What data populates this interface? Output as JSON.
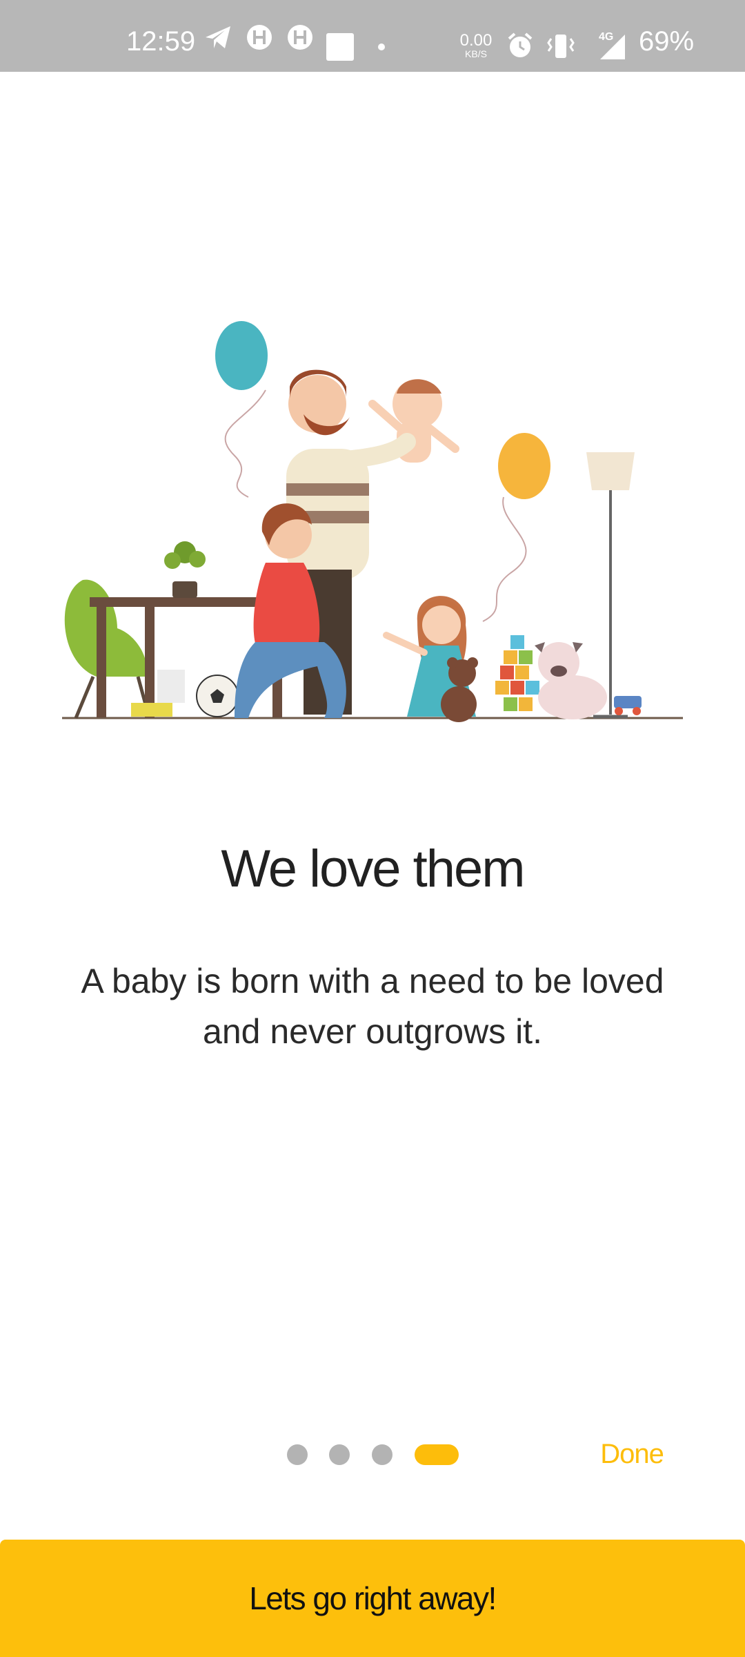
{
  "status_bar": {
    "time": "12:59",
    "net_speed_value": "0.00",
    "net_speed_unit": "KB/S",
    "network": "4G",
    "battery": "69%",
    "icons": [
      "telegram-icon",
      "hotstar-icon",
      "hotstar-icon",
      "square-notification-icon",
      "dot-icon",
      "alarm-icon",
      "vibrate-icon",
      "signal-icon"
    ]
  },
  "onboarding": {
    "illustration": "family-with-baby-illustration",
    "title": "We love them",
    "description": "A baby is born with a need to be loved and never outgrows it.",
    "page_count": 4,
    "current_page": 4,
    "done_label": "Done"
  },
  "cta": {
    "label": "Lets go right away!"
  },
  "colors": {
    "accent": "#fdbd0b",
    "status_bar": "#b7b7b7",
    "dot_inactive": "#b3b3b3"
  }
}
